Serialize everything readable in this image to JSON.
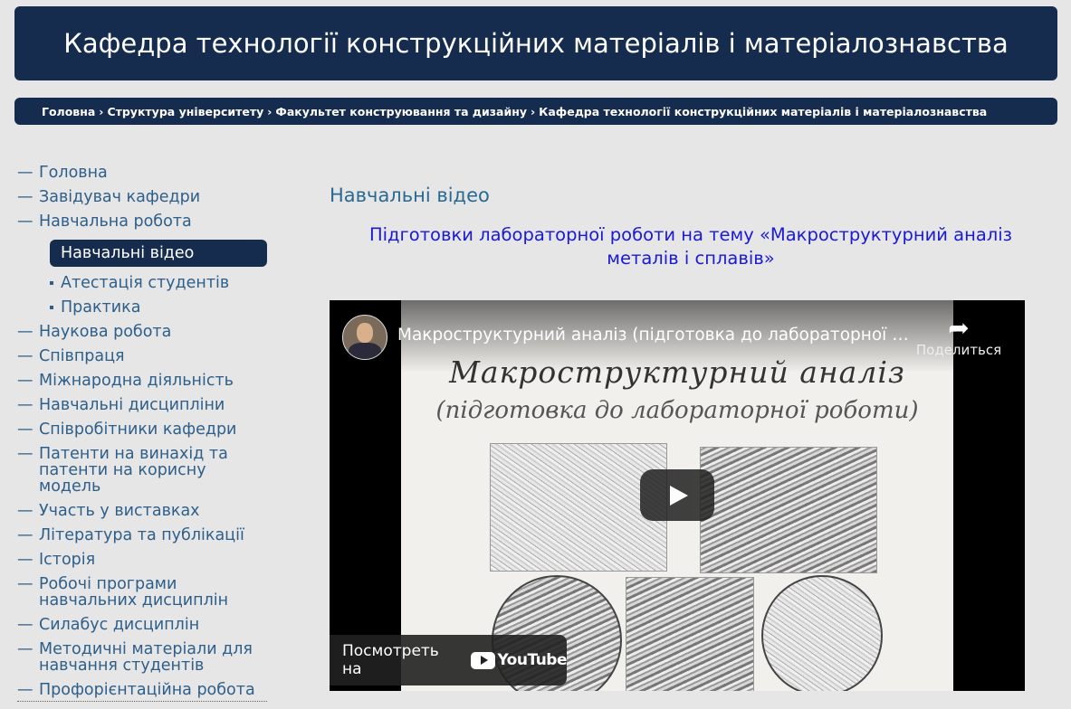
{
  "header": {
    "title": "Кафедра технології конструкційних матеріалів і матеріалознавства"
  },
  "breadcrumb": [
    "Головна",
    "Структура університету",
    "Факультет конструювання та дизайну",
    "Кафедра технології конструкційних матеріалів і матеріалознавства"
  ],
  "breadcrumb_separator": "›",
  "sidebar": {
    "dash": "—",
    "items_top": [
      "Головна",
      "Завідувач кафедри",
      "Навчальна робота"
    ],
    "active_item": "Навчальні відео",
    "sub_items": [
      "Атестація студентів",
      "Практика"
    ],
    "items_bottom": [
      "Наукова робота",
      "Співпраця",
      "Міжнародна діяльність",
      "Навчальні дисципліни",
      "Співробітники кафедри",
      "Патенти на винахід та патенти на корисну модель",
      "Участь у виставках",
      "Література та публікації",
      "Історія",
      "Робочі програми навчальних дисциплін",
      "Силабус дисциплін",
      "Методичні матеріали для навчання студентів",
      "Профорієнтаційна робота"
    ]
  },
  "main": {
    "heading": "Навчальні відео",
    "subtitle": "Підготовки лабораторної роботи на тему «Макроструктурний аналіз металів і сплавів»"
  },
  "video": {
    "title": "Макроструктурний аналіз (підготовка до лабораторної роботи)",
    "share_label": "Поделиться",
    "watch_on": "Посмотреть на",
    "youtube_label": "YouTube",
    "slide_title_1": "Макроструктурний аналіз",
    "slide_title_2": "(підготовка до лабораторної роботи)"
  },
  "colors": {
    "header_bg": "#152c4e",
    "page_bg": "#e6e6e6",
    "link": "#2e5f8a",
    "heading": "#2a6a92",
    "subtitle": "#1a1ad6"
  },
  "icons": {
    "share": "share-arrow-icon",
    "play": "play-icon",
    "youtube": "youtube-logo-icon"
  }
}
